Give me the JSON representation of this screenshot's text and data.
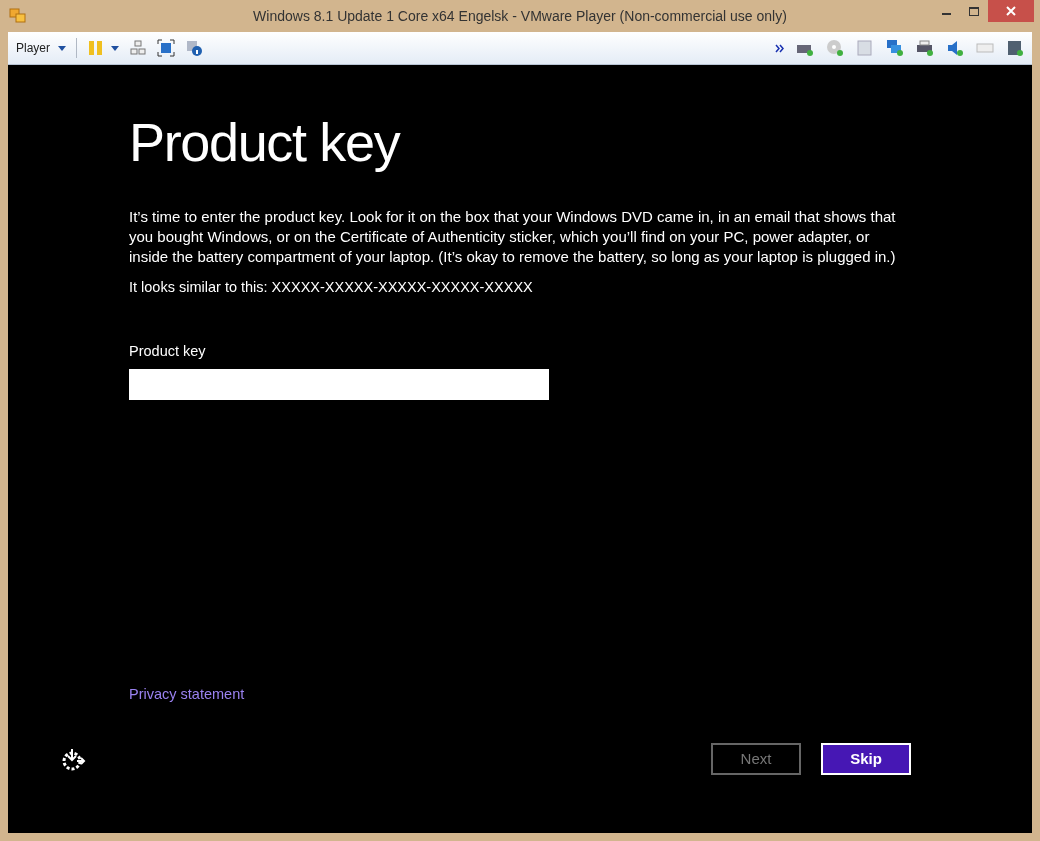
{
  "window": {
    "title": "Windows 8.1 Update 1 Core x64 Engelsk - VMware Player (Non-commercial use only)"
  },
  "toolbar": {
    "menu_label": "Player"
  },
  "setup": {
    "heading": "Product key",
    "description": "It’s time to enter the product key. Look for it on the box that your Windows DVD came in, in an email that shows that you bought Windows, or on the Certificate of Authenticity sticker, which you’ll find on your PC, power adapter, or inside the battery compartment of your laptop. (It’s okay to remove the battery, so long as your laptop is plugged in.)",
    "example": "It looks similar to this: XXXXX-XXXXX-XXXXX-XXXXX-XXXXX",
    "field_label": "Product key",
    "privacy_link": "Privacy statement",
    "buttons": [
      {
        "label": "Next",
        "disabled": true,
        "primary": false
      },
      {
        "label": "Skip",
        "disabled": false,
        "primary": true
      }
    ]
  }
}
